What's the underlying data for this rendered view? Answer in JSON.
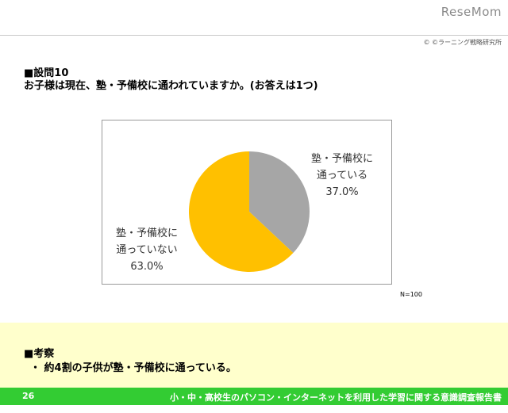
{
  "brand": "ReseMom",
  "copyright": "©  ©ラーニング戦略研究所",
  "question": {
    "number": "■設問10",
    "text": "お子様は現在、塾・予備校に通われていますか。(お答えは1つ)"
  },
  "chart_data": {
    "type": "pie",
    "title": "",
    "slices": [
      {
        "label_line1": "塾・予備校に",
        "label_line2": "通っている",
        "value": 37.0,
        "value_label": "37.0%",
        "color": "#a6a6a6"
      },
      {
        "label_line1": "塾・予備校に",
        "label_line2": "通っていない",
        "value": 63.0,
        "value_label": "63.0%",
        "color": "#ffc000"
      }
    ]
  },
  "sample_note": "N=100",
  "consideration": {
    "title": "■考察",
    "point": "・ 約4割の子供が塾・予備校に通っている。"
  },
  "footer": {
    "page_number": "26",
    "title": "小・中・高校生のパソコン・インターネットを利用した学習に関する意識調査報告書",
    "color": "#33cc33"
  }
}
